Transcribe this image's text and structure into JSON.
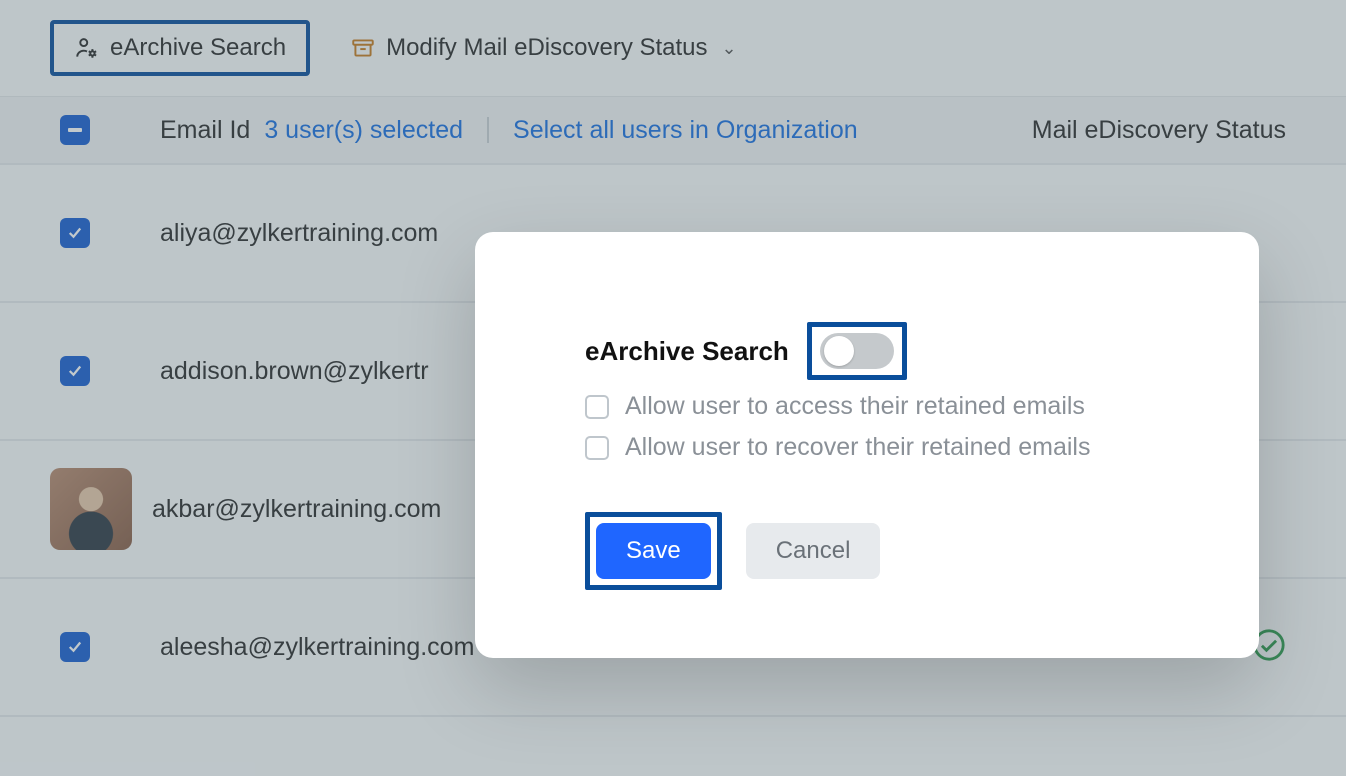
{
  "toolbar": {
    "earchive_label": "eArchive Search",
    "modify_label": "Modify Mail eDiscovery Status"
  },
  "header": {
    "email_col": "Email Id",
    "selected_summary": "3 user(s) selected",
    "select_all": "Select all users in Organization",
    "status_col": "Mail eDiscovery Status"
  },
  "rows": [
    {
      "email": "aliya@zylkertraining.com",
      "checked": true,
      "has_avatar": false,
      "status_enabled": false
    },
    {
      "email": "addison.brown@zylkertraining.com",
      "checked": true,
      "has_avatar": false,
      "status_enabled": false,
      "display_truncated": "addison.brown@zylkertr"
    },
    {
      "email": "akbar@zylkertraining.com",
      "checked": false,
      "has_avatar": true,
      "status_enabled": false
    },
    {
      "email": "aleesha@zylkertraining.com",
      "checked": true,
      "has_avatar": false,
      "status_enabled": true
    }
  ],
  "modal": {
    "title": "eArchive Search",
    "toggle_on": false,
    "option_access": "Allow user to access their retained emails",
    "option_recover": "Allow user to recover their retained emails",
    "save_label": "Save",
    "cancel_label": "Cancel"
  },
  "colors": {
    "accent": "#1a5fd1",
    "highlight_border": "#0a4e9b",
    "primary_btn": "#1f66ff"
  }
}
